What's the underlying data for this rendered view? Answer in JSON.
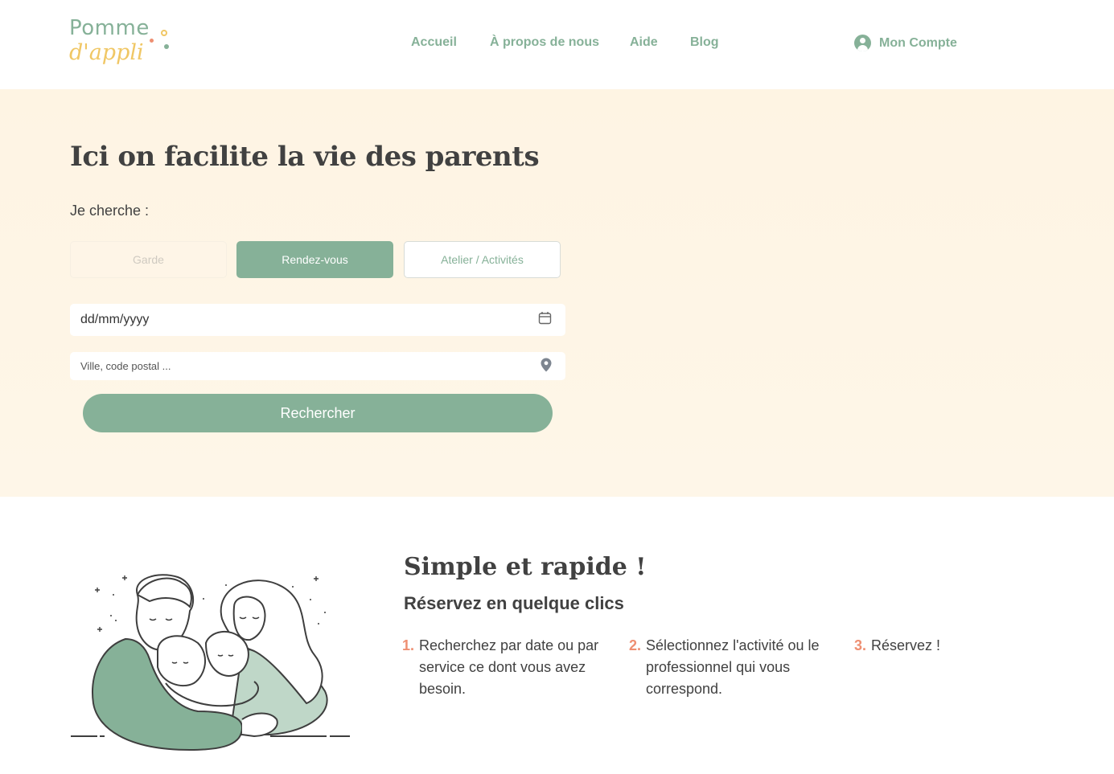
{
  "header": {
    "logo": {
      "line1": "Pomme",
      "line2": "d'appli"
    },
    "nav": [
      {
        "label": "Accueil"
      },
      {
        "label": "À propos de nous"
      },
      {
        "label": "Aide"
      },
      {
        "label": "Blog"
      }
    ],
    "account": {
      "label": "Mon Compte",
      "icon": "user-circle-icon"
    }
  },
  "hero": {
    "title": "Ici on facilite la vie des parents",
    "search_label": "Je cherche :",
    "segments": [
      {
        "label": "Garde",
        "state": "disabled"
      },
      {
        "label": "Rendez-vous",
        "state": "selected"
      },
      {
        "label": "Atelier / Activités",
        "state": "default"
      }
    ],
    "date_field": {
      "value": "dd/mm/yyyy",
      "icon": "calendar-icon"
    },
    "location_field": {
      "placeholder": "Ville, code postal ...",
      "icon": "map-pin-icon"
    },
    "search_button": "Rechercher"
  },
  "how": {
    "title": "Simple et rapide !",
    "subtitle": "Réservez en quelque clics",
    "steps": [
      {
        "num": "1.",
        "text": "Recherchez par date ou par service ce dont vous avez besoin."
      },
      {
        "num": "2.",
        "text": "Sélectionnez l'activité ou le professionnel qui vous correspond."
      },
      {
        "num": "3.",
        "text": "Réservez !"
      }
    ]
  },
  "colors": {
    "brand_green": "#86b198",
    "brand_yellow": "#f0c765",
    "accent_orange": "#ee8f72",
    "hero_bg": "#fef5e7",
    "text_dark": "#414141"
  }
}
